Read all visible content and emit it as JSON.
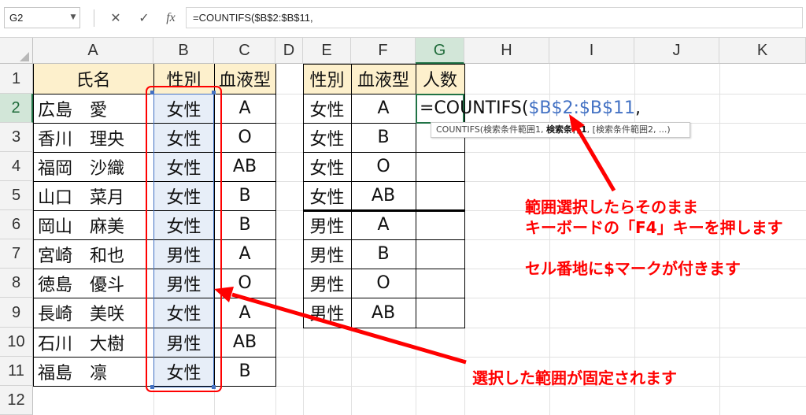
{
  "formula_bar": {
    "name_box": "G2",
    "cancel_icon": "✕",
    "enter_icon": "✓",
    "fx_label": "fx",
    "formula": "=COUNTIFS($B$2:$B$11,"
  },
  "columns": [
    "A",
    "B",
    "C",
    "D",
    "E",
    "F",
    "G",
    "H",
    "I",
    "J",
    "K"
  ],
  "rows": [
    "1",
    "2",
    "3",
    "4",
    "5",
    "6",
    "7",
    "8",
    "9",
    "10",
    "11",
    "12"
  ],
  "left_table": {
    "headers": [
      "氏名",
      "性別",
      "血液型"
    ],
    "rows": [
      [
        "広島　愛",
        "女性",
        "A"
      ],
      [
        "香川　理央",
        "女性",
        "O"
      ],
      [
        "福岡　沙織",
        "女性",
        "AB"
      ],
      [
        "山口　菜月",
        "女性",
        "B"
      ],
      [
        "岡山　麻美",
        "女性",
        "B"
      ],
      [
        "宮崎　和也",
        "男性",
        "A"
      ],
      [
        "徳島　優斗",
        "男性",
        "O"
      ],
      [
        "長崎　美咲",
        "女性",
        "A"
      ],
      [
        "石川　大樹",
        "男性",
        "AB"
      ],
      [
        "福島　凛",
        "女性",
        "B"
      ]
    ]
  },
  "right_table": {
    "headers": [
      "性別",
      "血液型",
      "人数"
    ],
    "rows": [
      [
        "女性",
        "A",
        ""
      ],
      [
        "女性",
        "B",
        ""
      ],
      [
        "女性",
        "O",
        ""
      ],
      [
        "女性",
        "AB",
        ""
      ],
      [
        "男性",
        "A",
        ""
      ],
      [
        "男性",
        "B",
        ""
      ],
      [
        "男性",
        "O",
        ""
      ],
      [
        "男性",
        "AB",
        ""
      ]
    ]
  },
  "editing": {
    "prefix": "=COUNTIFS(",
    "ref": "$B$2:$B$11",
    "suffix": ","
  },
  "tooltip": {
    "fn": "COUNTIFS(",
    "arg1": "検索条件範囲1, ",
    "arg2": "検索条件1",
    "rest": ", [検索条件範囲2, ...)"
  },
  "annotations": {
    "line1": "範囲選択したらそのまま",
    "line2": "キーボードの「F4」キーを押します",
    "line3": "セル番地に$マークが付きます",
    "line4": "選択した範囲が固定されます"
  },
  "colors": {
    "accent_green": "#217346",
    "header_fill": "#fdf0cc",
    "selection_fill": "#e7eef8",
    "reference_blue": "#4472c4",
    "annotation_red": "#ff0000"
  }
}
